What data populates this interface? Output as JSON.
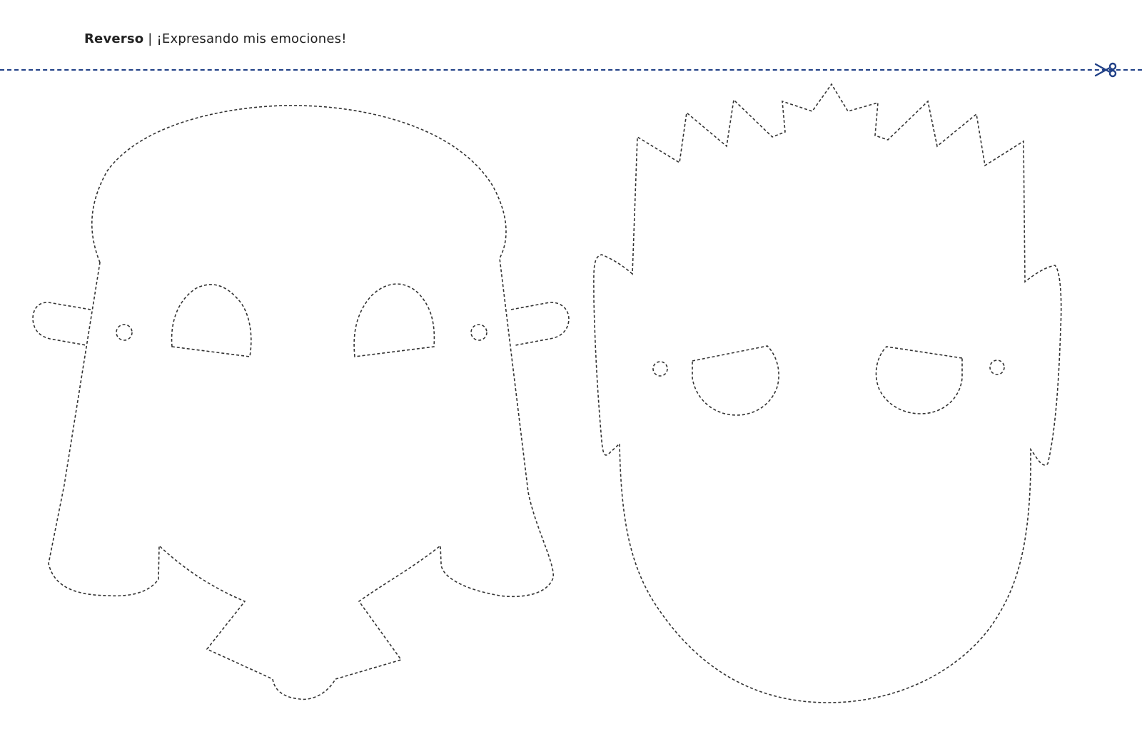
{
  "header": {
    "label": "Reverso",
    "separator": " | ",
    "title": "¡Expresando mis emociones!"
  },
  "cut_line": {
    "color": "#1f3f86",
    "icon": "scissors-icon"
  },
  "masks": [
    {
      "name": "mask-left-monster"
    },
    {
      "name": "mask-right-spiky-hair"
    }
  ]
}
